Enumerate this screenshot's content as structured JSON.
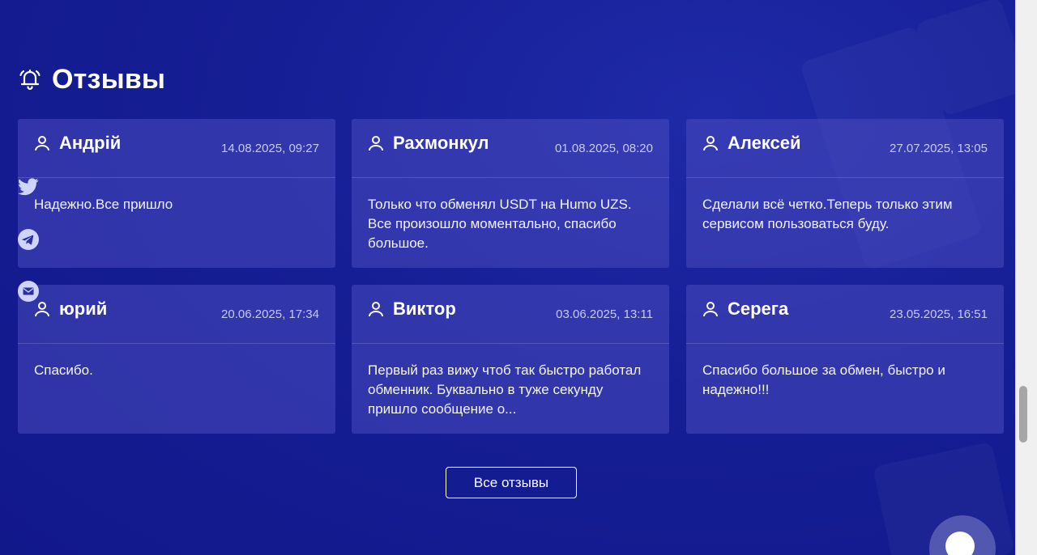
{
  "section": {
    "title": "Отзывы",
    "icon": "bell-icon"
  },
  "reviews": [
    {
      "name": "Андрій",
      "date": "14.08.2025, 09:27",
      "text": "Надежно.Все пришло"
    },
    {
      "name": "Рахмонкул",
      "date": "01.08.2025, 08:20",
      "text": "Только что обменял USDT на Humo UZS. Все произошло моментально, спасибо большое."
    },
    {
      "name": "Алексей",
      "date": "27.07.2025, 13:05",
      "text": "Сделали всё четко.Теперь только этим сервисом пользоваться буду."
    },
    {
      "name": "юрий",
      "date": "20.06.2025, 17:34",
      "text": "Спасибо."
    },
    {
      "name": "Виктор",
      "date": "03.06.2025, 13:11",
      "text": "Первый раз вижу чтоб так быстро работал обменник. Буквально в туже секунду пришло сообщение о..."
    },
    {
      "name": "Серега",
      "date": "23.05.2025, 16:51",
      "text": "Спасибо большое за обмен, быстро и надежно!!!"
    }
  ],
  "all_reviews_button": "Все отзывы",
  "social": [
    "twitter-icon",
    "telegram-icon",
    "mail-icon"
  ],
  "colors": {
    "background": "#161e95",
    "card": "#3a3cb0",
    "accent": "#ffffff"
  }
}
